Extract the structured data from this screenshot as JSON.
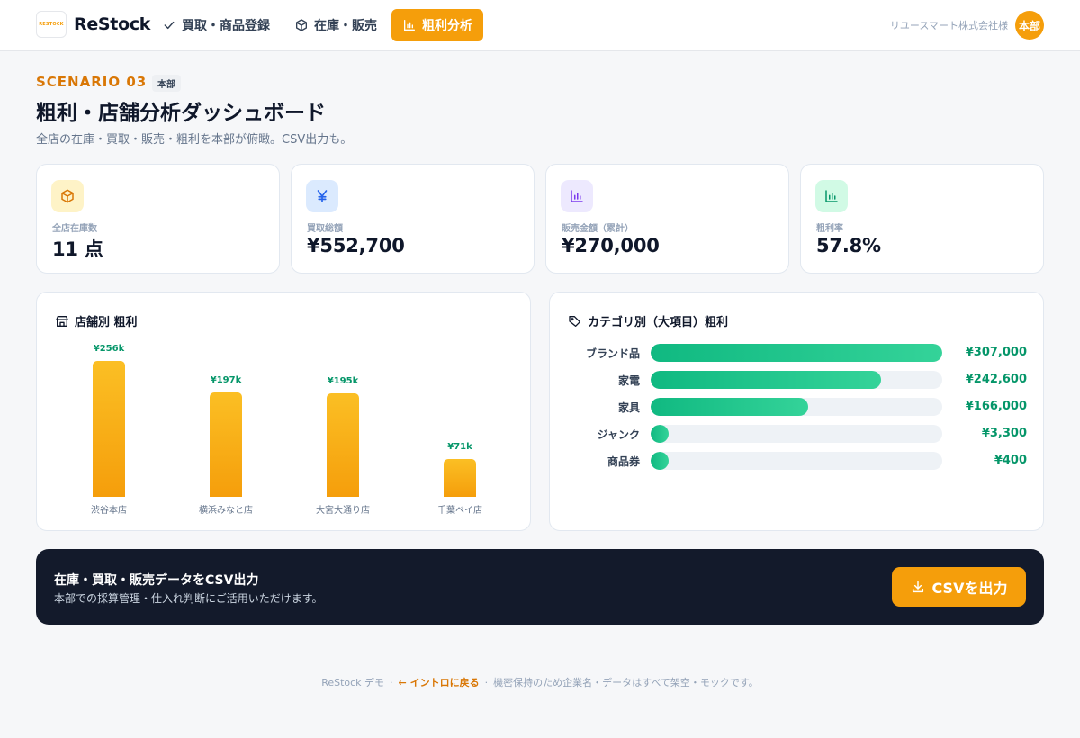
{
  "header": {
    "logo_text": "ReStock",
    "logo_mark": "RESTOCK",
    "nav": [
      {
        "label": "買取・商品登録",
        "icon": "check-icon"
      },
      {
        "label": "在庫・販売",
        "icon": "box-icon"
      },
      {
        "label": "粗利分析",
        "icon": "bar-chart-icon",
        "active": true
      }
    ],
    "company": "リユースマート株式会社様",
    "avatar": "本部"
  },
  "page": {
    "scenario": "SCENARIO 03",
    "scenario_badge": "本部",
    "title": "粗利・店舗分析ダッシュボード",
    "subtitle": "全店の在庫・買取・販売・粗利を本部が俯瞰。CSV出力も。"
  },
  "kpis": [
    {
      "label": "全店在庫数",
      "value": "11 点",
      "icon": "box-icon",
      "color": "#d97706",
      "bg": "#fef3c7"
    },
    {
      "label": "買取総額",
      "value": "¥552,700",
      "icon": "yen-icon",
      "color": "#2563eb",
      "bg": "#dbeafe"
    },
    {
      "label": "販売金額（累計）",
      "value": "¥270,000",
      "icon": "bar-chart-icon",
      "color": "#7c3aed",
      "bg": "#ede9fe"
    },
    {
      "label": "粗利率",
      "value": "57.8%",
      "icon": "bar-chart-icon",
      "color": "#059669",
      "bg": "#d1fae5"
    }
  ],
  "store_panel": {
    "title": "店舗別 粗利",
    "icon": "store-icon"
  },
  "category_panel": {
    "title": "カテゴリ別（大項目）粗利",
    "icon": "tag-icon"
  },
  "chart_data": [
    {
      "type": "bar",
      "title": "店舗別 粗利",
      "categories": [
        "渋谷本店",
        "横浜みなと店",
        "大宮大通り店",
        "千葉ベイ店"
      ],
      "values": [
        256000,
        197000,
        195000,
        71000
      ],
      "labels": [
        "¥256k",
        "¥197k",
        "¥195k",
        "¥71k"
      ],
      "color": "#f59e0b"
    },
    {
      "type": "bar",
      "orientation": "horizontal",
      "title": "カテゴリ別（大項目）粗利",
      "categories": [
        "ブランド品",
        "家電",
        "家具",
        "ジャンク",
        "商品券"
      ],
      "values": [
        307000,
        242600,
        166000,
        3300,
        400
      ],
      "labels": [
        "¥307,000",
        "¥242,600",
        "¥166,000",
        "¥3,300",
        "¥400"
      ],
      "color": "#10b981"
    }
  ],
  "csv": {
    "title": "在庫・買取・販売データをCSV出力",
    "subtitle": "本部での採算管理・仕入れ判断にご活用いただけます。",
    "button": "CSVを出力",
    "icon": "download-icon"
  },
  "footer": {
    "prefix": "ReStock デモ",
    "link": "← イントロに戻る",
    "note": "機密保持のため企業名・データはすべて架空・モックです。"
  }
}
